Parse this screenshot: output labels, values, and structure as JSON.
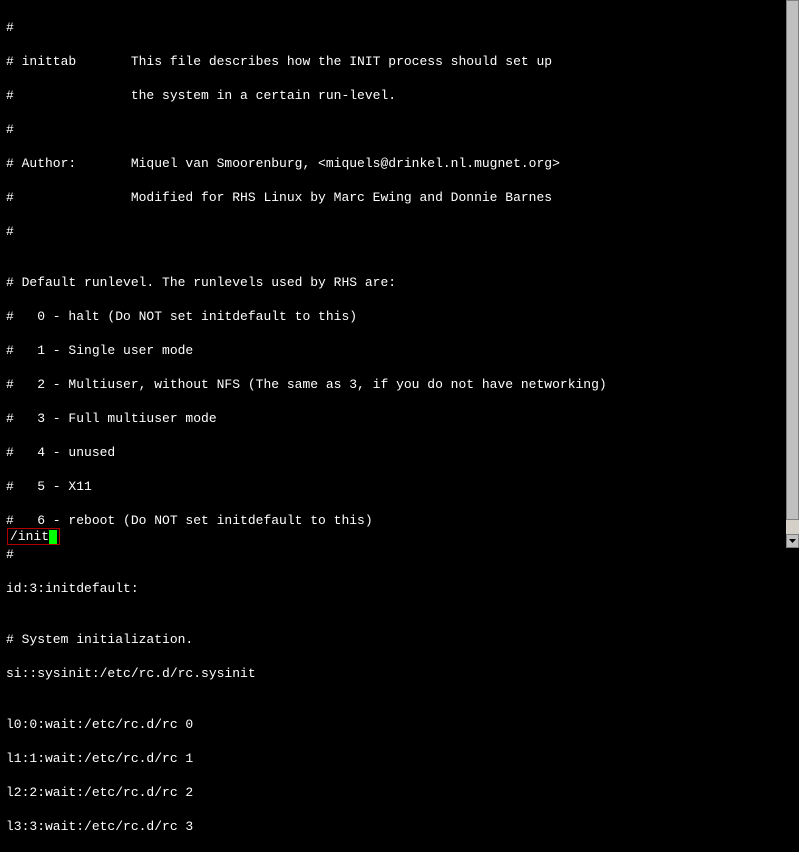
{
  "terminal": {
    "lines": [
      "#",
      "# inittab       This file describes how the INIT process should set up",
      "#               the system in a certain run-level.",
      "#",
      "# Author:       Miquel van Smoorenburg, <miquels@drinkel.nl.mugnet.org>",
      "#               Modified for RHS Linux by Marc Ewing and Donnie Barnes",
      "#",
      "",
      "# Default runlevel. The runlevels used by RHS are:",
      "#   0 - halt (Do NOT set initdefault to this)",
      "#   1 - Single user mode",
      "#   2 - Multiuser, without NFS (The same as 3, if you do not have networking)",
      "#   3 - Full multiuser mode",
      "#   4 - unused",
      "#   5 - X11",
      "#   6 - reboot (Do NOT set initdefault to this)",
      "#",
      "id:3:initdefault:",
      "",
      "# System initialization.",
      "si::sysinit:/etc/rc.d/rc.sysinit",
      "",
      "l0:0:wait:/etc/rc.d/rc 0",
      "l1:1:wait:/etc/rc.d/rc 1",
      "l2:2:wait:/etc/rc.d/rc 2",
      "l3:3:wait:/etc/rc.d/rc 3"
    ]
  },
  "search": {
    "query": "/init"
  }
}
